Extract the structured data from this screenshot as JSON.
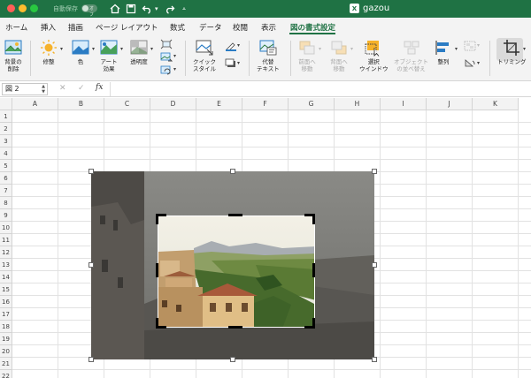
{
  "titlebar": {
    "autosave_label": "自動保存",
    "autosave_state": "オフ",
    "doc_name": "gazou"
  },
  "tabs": [
    "ホーム",
    "挿入",
    "描画",
    "ページ レイアウト",
    "数式",
    "データ",
    "校閲",
    "表示",
    "図の書式設定"
  ],
  "active_tab": "図の書式設定",
  "ribbon": {
    "remove_bg": [
      "背景の",
      "削除"
    ],
    "corrections": "修整",
    "color": "色",
    "artistic": [
      "アート",
      "効果"
    ],
    "transparency": "透明度",
    "quick_styles": [
      "クイック",
      "スタイル"
    ],
    "alt_text": [
      "代替",
      "テキスト"
    ],
    "bring_forward": [
      "前面へ",
      "移動"
    ],
    "send_backward": [
      "背面へ",
      "移動"
    ],
    "selection_pane": [
      "選択",
      "ウインドウ"
    ],
    "align_objects": [
      "オブジェクト",
      "の並べ替え"
    ],
    "arrange": "整列",
    "crop": "トリミング"
  },
  "formula_bar": {
    "name_box": "図 2",
    "fx": "fx"
  },
  "columns": [
    "A",
    "B",
    "C",
    "D",
    "E",
    "F",
    "G",
    "H",
    "I",
    "J",
    "K"
  ],
  "rows": [
    "1",
    "2",
    "3",
    "4",
    "5",
    "6",
    "7",
    "8",
    "9",
    "10",
    "11",
    "12",
    "13",
    "14",
    "15",
    "16",
    "17",
    "18",
    "19",
    "20",
    "21",
    "22"
  ],
  "colors": {
    "accent": "#1f7244",
    "ribbon_bg": "#f3f3f3"
  }
}
